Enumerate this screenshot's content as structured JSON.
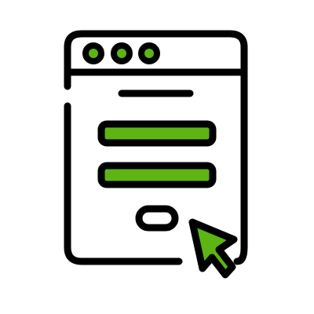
{
  "icon": {
    "name": "web-form-cursor-icon",
    "parts": [
      "browser-window-icon",
      "window-dots-icon",
      "title-line-icon",
      "input-field-icon",
      "submit-button-icon",
      "mouse-pointer-icon"
    ]
  },
  "colors": {
    "background": "#ffffff",
    "outline": "#000000",
    "accent": "#5cb513"
  }
}
